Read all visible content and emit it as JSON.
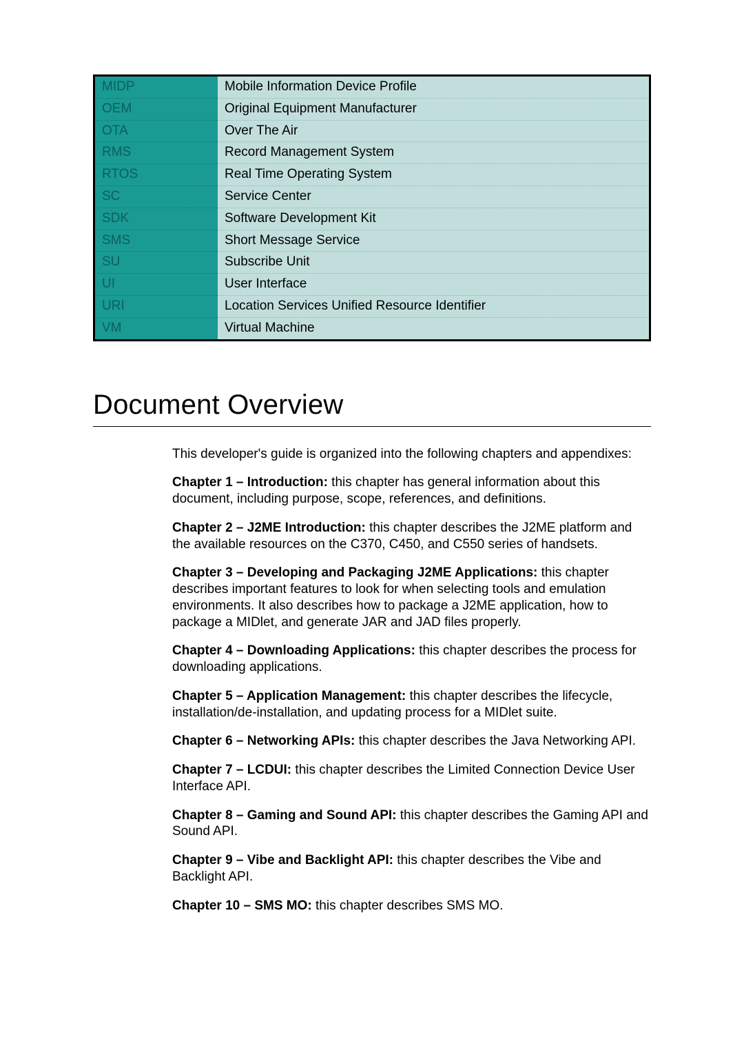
{
  "definitions": [
    {
      "abbr": "MIDP",
      "desc": "Mobile Information Device Profile"
    },
    {
      "abbr": "OEM",
      "desc": "Original Equipment Manufacturer"
    },
    {
      "abbr": "OTA",
      "desc": "Over The Air"
    },
    {
      "abbr": "RMS",
      "desc": "Record Management System"
    },
    {
      "abbr": "RTOS",
      "desc": "Real Time Operating System"
    },
    {
      "abbr": "SC",
      "desc": "Service Center"
    },
    {
      "abbr": "SDK",
      "desc": "Software Development Kit"
    },
    {
      "abbr": "SMS",
      "desc": "Short Message Service"
    },
    {
      "abbr": "SU",
      "desc": "Subscribe Unit"
    },
    {
      "abbr": "UI",
      "desc": "User Interface"
    },
    {
      "abbr": "URI",
      "desc": "Location Services Unified Resource Identifier"
    },
    {
      "abbr": "VM",
      "desc": "Virtual Machine"
    }
  ],
  "section_title": "Document Overview",
  "intro": "This developer's guide is organized into the following chapters and appendixes:",
  "chapters": [
    {
      "label": "Chapter 1 – Introduction:",
      "text": " this chapter has general information about this document, including purpose, scope, references, and definitions."
    },
    {
      "label": "Chapter 2 – J2ME Introduction:",
      "text": " this chapter describes the J2ME platform and the available resources on the C370, C450, and C550 series of handsets."
    },
    {
      "label": "Chapter 3 – Developing and Packaging J2ME Applications:",
      "text": " this chapter describes important features to look for when selecting tools and emulation environments. It also describes how to package a J2ME application, how to package a MIDlet, and generate JAR and JAD files properly."
    },
    {
      "label": "Chapter 4 – Downloading Applications:",
      "text": " this chapter describes the process for downloading applications."
    },
    {
      "label": "Chapter 5 – Application Management:",
      "text": " this chapter describes the lifecycle, installation/de-installation, and updating process for a MIDlet suite."
    },
    {
      "label": "Chapter 6 – Networking APIs:",
      "text": " this chapter describes the Java Networking API."
    },
    {
      "label": "Chapter 7 – LCDUI:",
      "text": " this chapter describes the Limited Connection Device User Interface API."
    },
    {
      "label": "Chapter 8 – Gaming and Sound API:",
      "text": " this chapter describes the Gaming API and Sound API."
    },
    {
      "label": "Chapter 9 – Vibe and Backlight API:",
      "text": " this chapter describes the Vibe and Backlight API."
    },
    {
      "label": "Chapter 10 – SMS MO:",
      "text": " this chapter describes SMS MO."
    }
  ]
}
